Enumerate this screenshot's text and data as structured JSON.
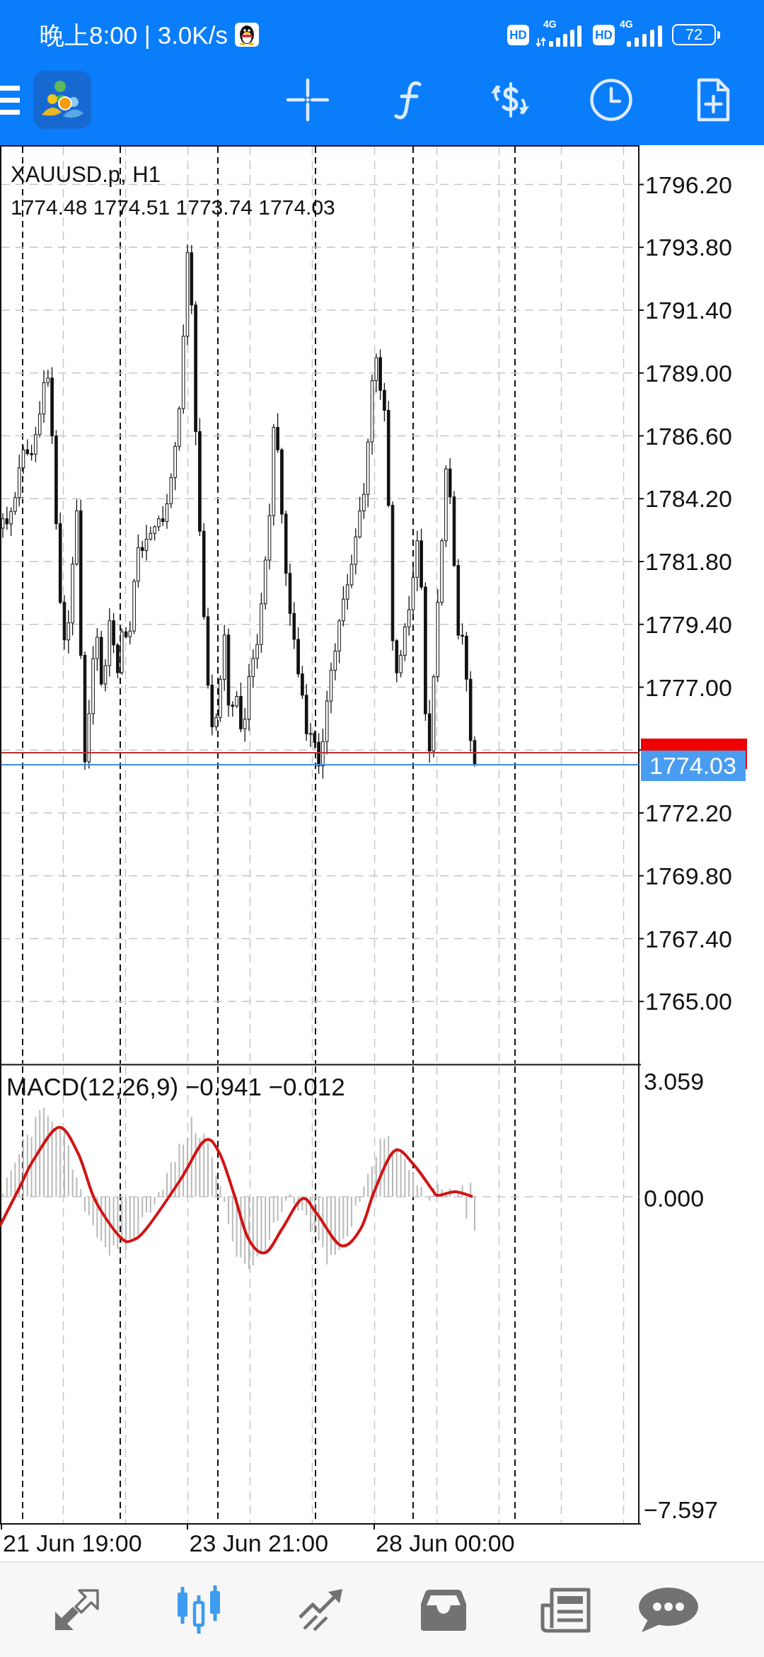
{
  "status_bar": {
    "status_text": "晚上8:00 | 3.0K/s",
    "networks": [
      {
        "badge": "HD",
        "type": "4G"
      },
      {
        "badge": "HD",
        "type": "4G"
      }
    ],
    "battery": "72"
  },
  "chart": {
    "symbol": "XAUUSD.p, H1",
    "ohlc": "1774.48 1774.51 1773.74 1774.03",
    "price_axis": [
      "1796.20",
      "1793.80",
      "1791.40",
      "1789.00",
      "1786.60",
      "1784.20",
      "1781.80",
      "1779.40",
      "1777.00",
      "1772.20",
      "1769.80",
      "1767.40",
      "1765.00"
    ],
    "bid_tag": "1774.03"
  },
  "macd": {
    "title": "MACD(12,26,9) −0.941 −0.012",
    "axis": [
      "3.059",
      "0.000",
      "−7.597"
    ]
  },
  "time_axis": [
    "21 Jun 19:00",
    "23 Jun 21:00",
    "28 Jun 00:00"
  ],
  "bottom_nav": {
    "items": [
      {
        "selected": false
      },
      {
        "selected": true
      },
      {
        "selected": false
      },
      {
        "selected": false
      },
      {
        "selected": false
      },
      {
        "selected": false
      }
    ]
  }
}
